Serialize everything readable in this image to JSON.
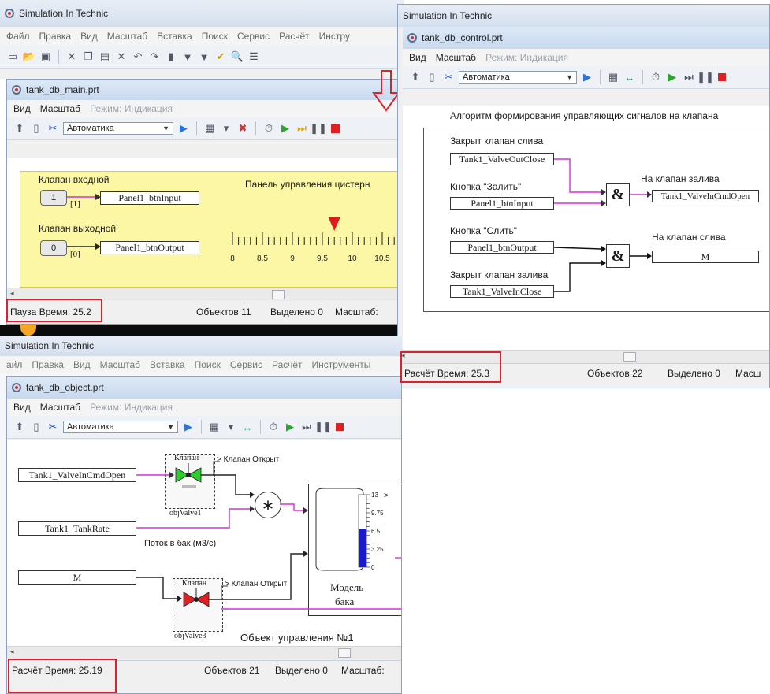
{
  "main_app": {
    "title": "Simulation In Technic",
    "menu": [
      "Файл",
      "Правка",
      "Вид",
      "Масштаб",
      "Вставка",
      "Поиск",
      "Сервис",
      "Расчёт",
      "Инстру"
    ]
  },
  "win_main": {
    "title": "tank_db_main.prt",
    "menu": {
      "view": "Вид",
      "scale": "Масштаб",
      "mode": "Режим:",
      "ind": "Индикация"
    },
    "combo": "Автоматика",
    "inlet_label": "Клапан входной",
    "inlet_btn_value": "1",
    "inlet_index": "[1]",
    "inlet_signal": "Panel1_btnInput",
    "outlet_label": "Клапан выходной",
    "outlet_btn_value": "0",
    "outlet_index": "[0]",
    "outlet_signal": "Panel1_btnOutput",
    "panel_title": "Панель управления цистерн",
    "scale_ticks": [
      "8",
      "8.5",
      "9",
      "9.5",
      "10",
      "10.5"
    ],
    "scale_marker_value": 9.7,
    "status": {
      "state": "Пауза",
      "time": "Время: 25.2",
      "objects": "Объектов 11",
      "selected": "Выделено 0",
      "scale": "Масштаб:"
    }
  },
  "win_control": {
    "app_title": "Simulation In Technic",
    "title": "tank_db_control.prt",
    "menu": {
      "view": "Вид",
      "scale": "Масштаб",
      "mode": "Режим:",
      "ind": "Индикация"
    },
    "combo": "Автоматика",
    "heading": "Алгоритм формирования управляющих сигналов на клапана",
    "lbl_drain_closed": "Закрыт клапан слива",
    "sig_drain_closed": "Tank1_ValveOutClose",
    "lbl_fill_btn": "Кнопка \"Залить\"",
    "sig_fill_btn": "Panel1_btnInput",
    "and1": "&",
    "lbl_to_fill": "На клапан залива",
    "out_fill": "Tank1_ValveInCmdOpen",
    "lbl_drain_btn": "Кнопка \"Слить\"",
    "sig_drain_btn": "Panel1_btnOutput",
    "and2": "&",
    "lbl_to_drain": "На клапан слива",
    "out_drain": "M",
    "lbl_fill_closed": "Закрыт клапан залива",
    "sig_fill_closed": "Tank1_ValveInClose",
    "status": {
      "state": "Расчёт",
      "time": "Время: 25.3",
      "objects": "Объектов 22",
      "selected": "Выделено 0",
      "scale": "Масш"
    }
  },
  "win_object": {
    "app_title": "Simulation In Technic",
    "app_menu": [
      "айл",
      "Правка",
      "Вид",
      "Масштаб",
      "Вставка",
      "Поиск",
      "Сервис",
      "Расчёт",
      "Инструменты"
    ],
    "title": "tank_db_object.prt",
    "menu": {
      "view": "Вид",
      "scale": "Масштаб",
      "mode": "Режим:",
      "ind": "Индикация"
    },
    "combo": "Автоматика",
    "sig_valve_in": "Tank1_ValveInCmdOpen",
    "valve1_header": "Клапан",
    "valve1_status": "> Клапан Открыт",
    "valve1_name": "objValve1",
    "multiply": "∗",
    "sig_tank_rate": "Tank1_TankRate",
    "flow_label": "Поток в бак (м3/с)",
    "sig_m": "M",
    "valve3_header": "Клапан",
    "valve3_status": "> Клапан Открыт",
    "valve3_name": "objValve3",
    "tank_label_1": "Модель",
    "tank_label_2": "бака",
    "tank_ticks": [
      "13",
      "9.75",
      "6.5",
      "3.25",
      "0"
    ],
    "tank_level_value": 6.8,
    "footer": "Объект управления №1",
    "status": {
      "state": "Расчёт",
      "time": "Время: 25.19",
      "objects": "Объектов 21",
      "selected": "Выделено 0",
      "scale": "Масштаб:"
    }
  },
  "colors": {
    "panel_yellow": "#fbf7a4",
    "highlight_red": "#d8232a",
    "signal_magenta": "#d631d6",
    "valve_green": "#2ecc2e",
    "valve_red": "#e02020",
    "level_blue": "#1a1ad0"
  }
}
